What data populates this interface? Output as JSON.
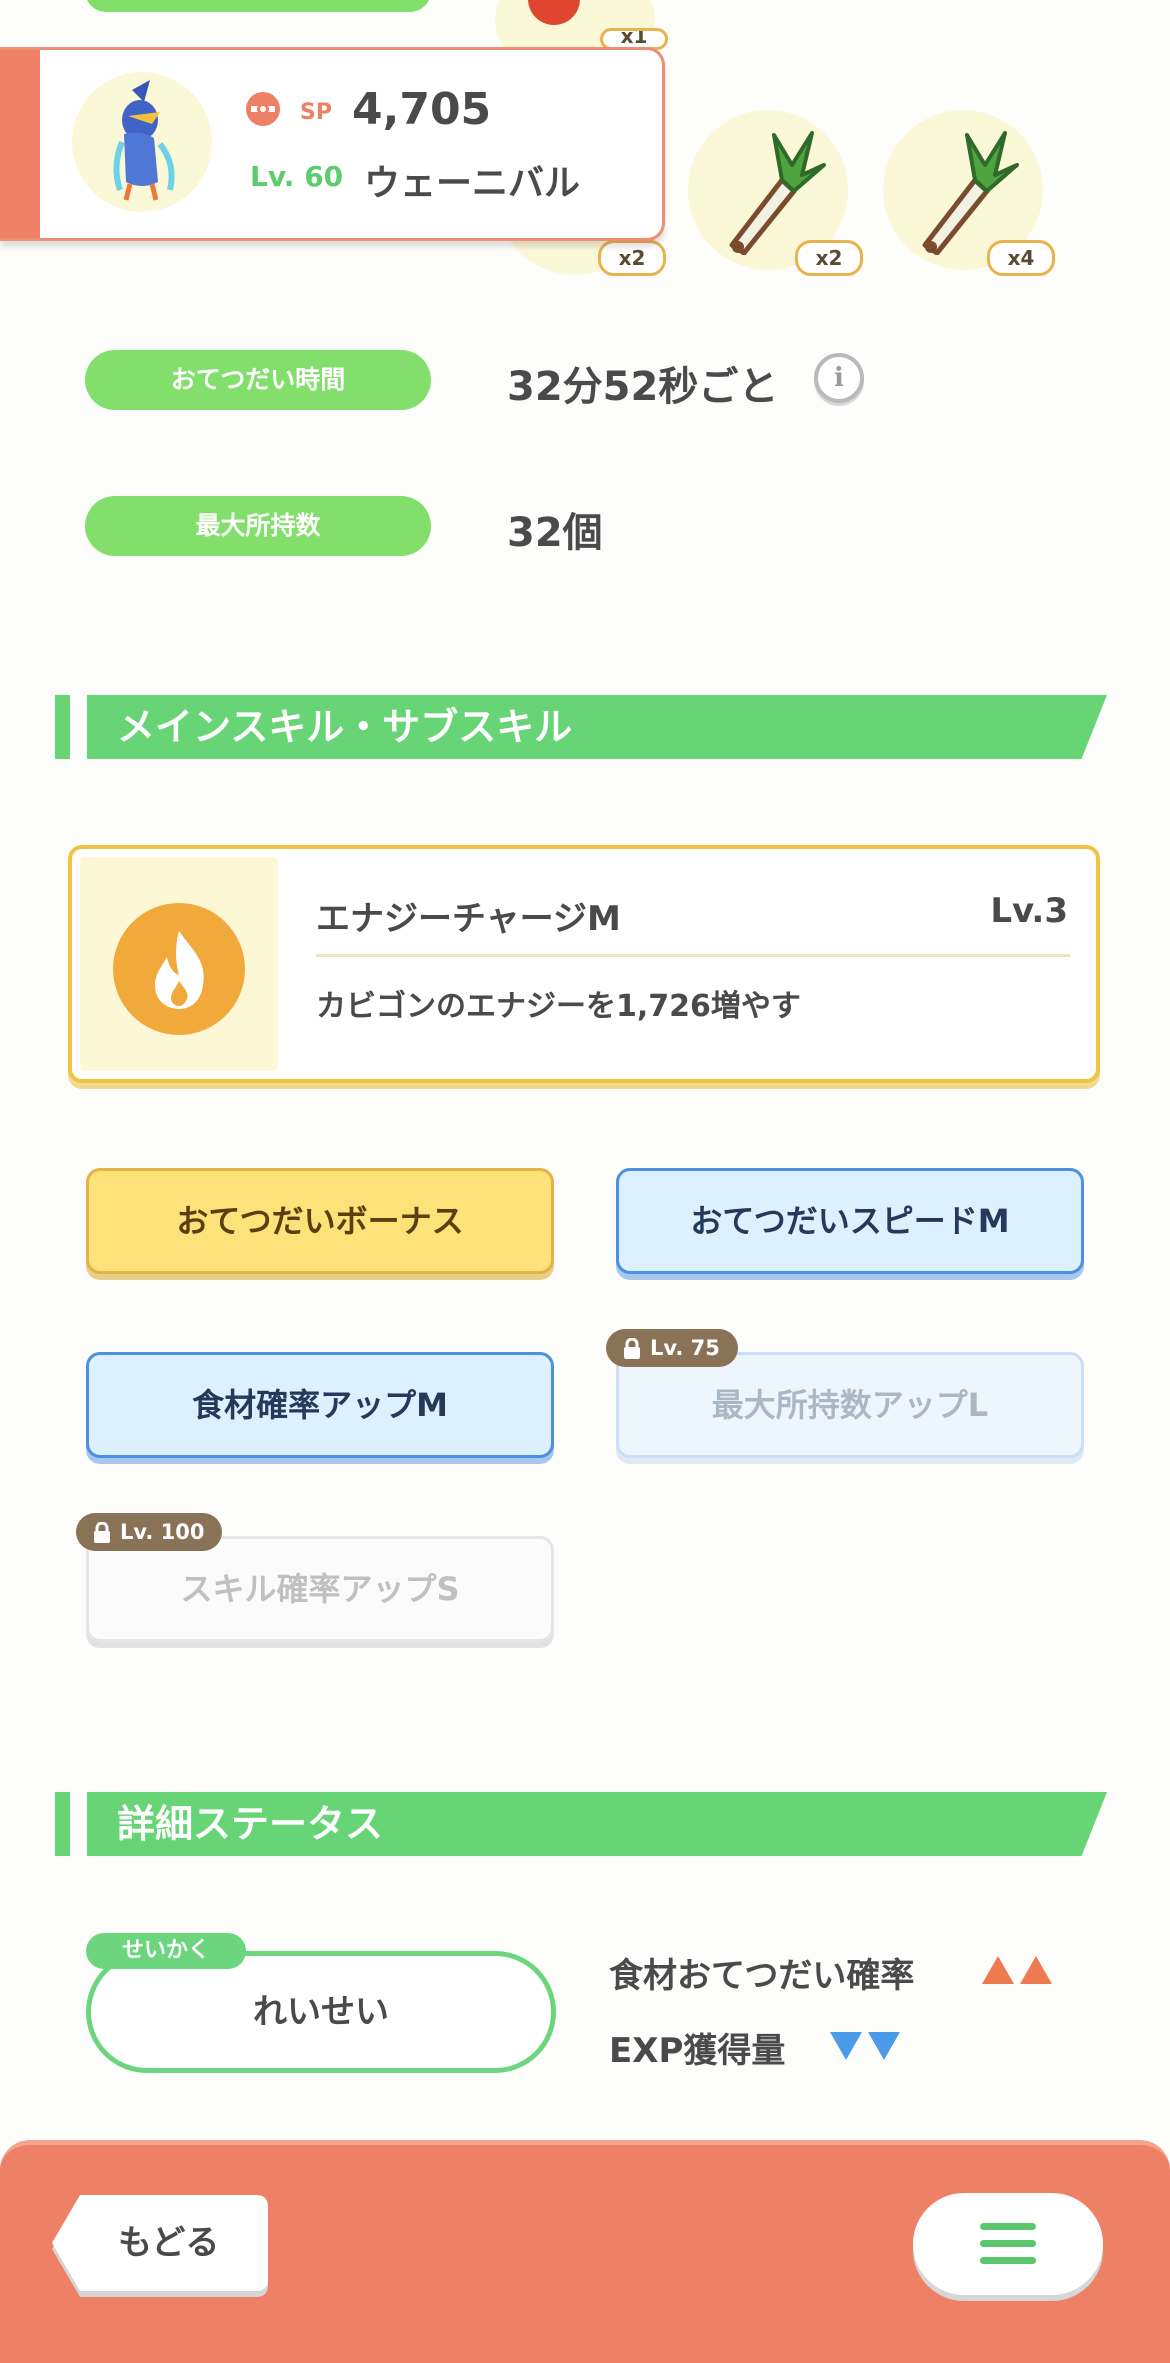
{
  "top_ingredients": {
    "items": [
      {
        "name": "red-ingredient-icon",
        "qty": "x1"
      },
      {
        "name": "leek-icon",
        "qty": "x2"
      },
      {
        "name": "leek-icon",
        "qty": "x2"
      },
      {
        "name": "leek-icon",
        "qty": "x4"
      }
    ]
  },
  "pokemon": {
    "sp_label": "SP",
    "sp_value": "4,705",
    "level": "Lv. 60",
    "name": "ウェーニバル"
  },
  "info": {
    "help_time_label": "おてつだい時間",
    "help_time_value": "32分52秒ごと",
    "max_carry_label": "最大所持数",
    "max_carry_value": "32個"
  },
  "skills_section": {
    "title": "メインスキル・サブスキル"
  },
  "main_skill": {
    "name": "エナジーチャージM",
    "level": "Lv.3",
    "description": "カビゴンのエナジーを1,726増やす"
  },
  "sub_skills": [
    {
      "label": "おてつだいボーナス",
      "style": "gold",
      "locked": false
    },
    {
      "label": "おてつだいスピードM",
      "style": "blue",
      "locked": false
    },
    {
      "label": "食材確率アップM",
      "style": "blue",
      "locked": false
    },
    {
      "label": "最大所持数アップL",
      "style": "blue",
      "locked": true,
      "unlock_level": "Lv. 75"
    },
    {
      "label": "スキル確率アップS",
      "style": "white",
      "locked": true,
      "unlock_level": "Lv. 100"
    }
  ],
  "details_section": {
    "title": "詳細ステータス"
  },
  "nature": {
    "tag": "せいかく",
    "value": "れいせい",
    "up_stat": "食材おてつだい確率",
    "down_stat": "EXP獲得量"
  },
  "bottom": {
    "back_label": "もどる"
  },
  "colors": {
    "accent_green": "#67d476",
    "accent_orange": "#ee8066",
    "gold": "#efc444",
    "up_arrow": "#ee7a52",
    "down_arrow": "#4a9be8"
  }
}
